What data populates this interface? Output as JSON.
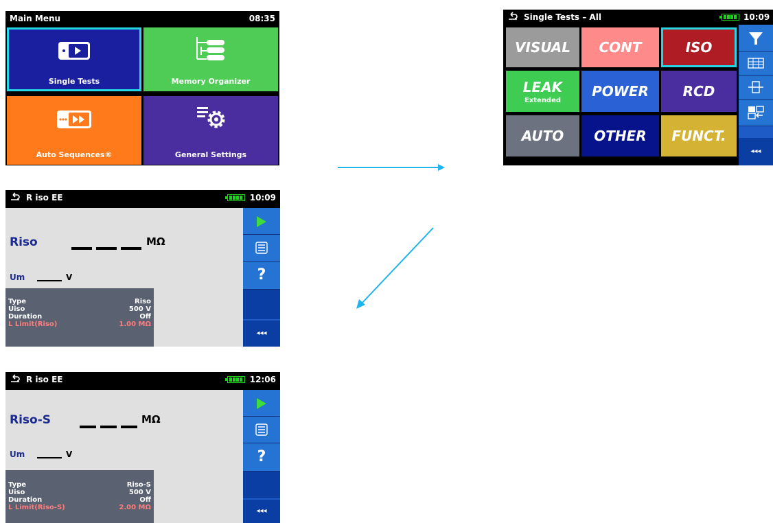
{
  "main_menu": {
    "title": "Main Menu",
    "clock": "08:35",
    "tiles": [
      {
        "label": "Single Tests",
        "icon": "single-tests-icon",
        "color": "#1a1fa0"
      },
      {
        "label": "Memory Organizer",
        "icon": "memory-organizer-icon",
        "color": "#4fcc55"
      },
      {
        "label": "Auto Sequences®",
        "icon": "auto-sequences-icon",
        "color": "#ff7a1a"
      },
      {
        "label": "General Settings",
        "icon": "general-settings-icon",
        "color": "#4a2ea0"
      }
    ]
  },
  "single_tests": {
    "title": "Single Tests – All",
    "clock": "10:09",
    "groups": [
      {
        "label": "VISUAL",
        "color": "#9b9b9b"
      },
      {
        "label": "CONT",
        "color": "#ff8a8a"
      },
      {
        "label": "ISO",
        "color": "#b01c24"
      },
      {
        "label": "LEAK",
        "sub": "Extended",
        "color": "#3fcc52"
      },
      {
        "label": "POWER",
        "color": "#2a62d6"
      },
      {
        "label": "RCD",
        "color": "#4a2ea0"
      },
      {
        "label": "AUTO",
        "color": "#6c7280"
      },
      {
        "label": "OTHER",
        "color": "#07138a"
      },
      {
        "label": "FUNCT.",
        "color": "#d4b234"
      }
    ],
    "side_icons": [
      "filter-icon",
      "grid-view-icon",
      "expand-icon",
      "switch-view-icon"
    ],
    "more_label": "◂◂◂"
  },
  "riso_screen": {
    "title": "R iso EE",
    "clock": "10:09",
    "main_label": "Riso",
    "main_unit": "MΩ",
    "sub_label": "Um",
    "sub_unit": "V",
    "params": [
      {
        "key": "Type",
        "value": "Riso"
      },
      {
        "key": "Uiso",
        "value": "500 V"
      },
      {
        "key": "Duration",
        "value": "Off"
      },
      {
        "key": "L Limit(Riso)",
        "value": "1.00 MΩ"
      }
    ],
    "more_label": "◂◂◂"
  },
  "risos_screen": {
    "title": "R iso EE",
    "clock": "12:06",
    "main_label": "Riso-S",
    "main_unit": "MΩ",
    "sub_label": "Um",
    "sub_unit": "V",
    "params": [
      {
        "key": "Type",
        "value": "Riso-S"
      },
      {
        "key": "Uiso",
        "value": "500 V"
      },
      {
        "key": "Duration",
        "value": "Off"
      },
      {
        "key": "L Limit(Riso-S)",
        "value": "2.00 MΩ"
      }
    ],
    "more_label": "◂◂◂"
  },
  "colors": {
    "arrow": "#1eb4ec",
    "accent_border": "#25d6e6",
    "param_limit": "#ff7c7c"
  }
}
